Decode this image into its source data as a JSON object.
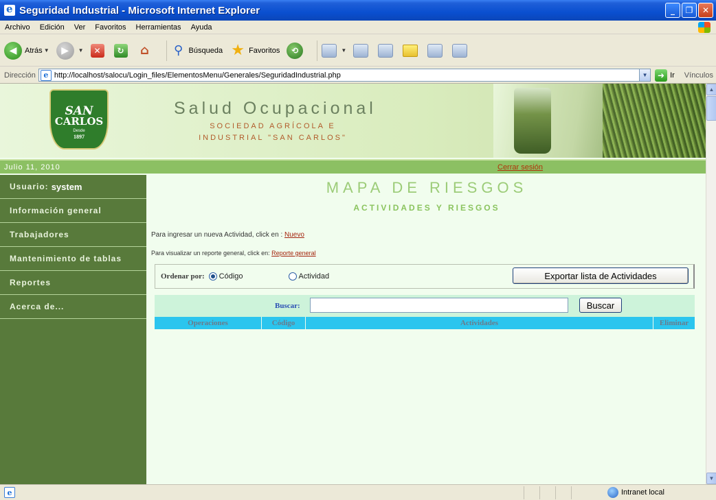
{
  "window": {
    "title": "Seguridad Industrial - Microsoft Internet Explorer"
  },
  "menu": [
    "Archivo",
    "Edición",
    "Ver",
    "Favoritos",
    "Herramientas",
    "Ayuda"
  ],
  "toolbar": {
    "back_label": "Atrás",
    "search_label": "Búsqueda",
    "favorites_label": "Favoritos"
  },
  "address": {
    "label": "Dirección",
    "url": "http://localhost/salocu/Login_files/ElementosMenu/Generales/SeguridadIndustrial.php",
    "go_label": "Ir",
    "links_label": "Vínculos"
  },
  "header": {
    "logo_line1": "SAN",
    "logo_line2": "CARLOS",
    "logo_line3": "Desde",
    "logo_line4": "1897",
    "title": "Salud Ocupacional",
    "subtitle_line1": "SOCIEDAD AGRÍCOLA E",
    "subtitle_line2": "INDUSTRIAL \"SAN CARLOS\""
  },
  "datebar": {
    "date": "Julio 11, 2010",
    "logout": "Cerrar sesión"
  },
  "sidebar": {
    "user_label": "Usuario:",
    "user_name": "system",
    "items": [
      "Información general",
      "Trabajadores",
      "Mantenimiento de tablas",
      "Reportes",
      "Acerca de..."
    ]
  },
  "main": {
    "title": "MAPA DE RIESGOS",
    "subtitle": "ACTIVIDADES Y RIESGOS",
    "new_text": "Para ingresar un nueva Actividad, click en : ",
    "new_link": "Nuevo",
    "report_text": "Para visualizar un reporte general, click en: ",
    "report_link": "Reporte general",
    "order_label": "Ordenar por:",
    "order_options": [
      "Código",
      "Actividad"
    ],
    "order_selected": "Código",
    "export_button": "Exportar lista de Actividades",
    "search_label": "Buscar:",
    "search_value": "",
    "search_button": "Buscar",
    "table_headers": [
      "Operaciones",
      "Código",
      "Actividades",
      "Eliminar"
    ]
  },
  "status": {
    "zone": "Intranet local"
  }
}
